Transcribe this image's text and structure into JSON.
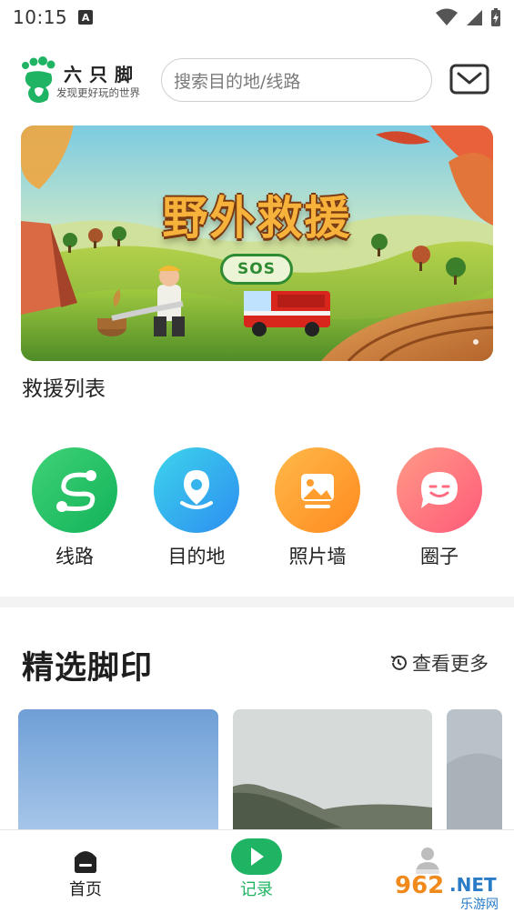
{
  "status_bar": {
    "time": "10:15",
    "notification_letter": "A"
  },
  "header": {
    "brand_name": "六只脚",
    "slogan": "发现更好玩的世界",
    "search_placeholder": "搜索目的地/线路"
  },
  "banner": {
    "title": "野外救援",
    "badge": "SOS"
  },
  "rescue_list_label": "救援列表",
  "quick_nav": [
    {
      "label": "线路",
      "icon": "route-icon",
      "color_from": "#3fd276",
      "color_to": "#13b25a"
    },
    {
      "label": "目的地",
      "icon": "location-pin-icon",
      "color_from": "#3dd4ec",
      "color_to": "#2d8ef0"
    },
    {
      "label": "照片墙",
      "icon": "photo-icon",
      "color_from": "#ffb94a",
      "color_to": "#ff8a1f"
    },
    {
      "label": "圈子",
      "icon": "chat-bubble-icon",
      "color_from": "#ff9a86",
      "color_to": "#ff5a7a"
    }
  ],
  "featured": {
    "title": "精选脚印",
    "view_more": "查看更多"
  },
  "bottom_nav": [
    {
      "label": "首页",
      "icon": "home-icon",
      "active": false
    },
    {
      "label": "记录",
      "icon": "record-icon",
      "active": true
    },
    {
      "label": "",
      "icon": "profile-icon",
      "active": false
    }
  ],
  "watermark": {
    "brand": "962.NET",
    "subtitle": "乐游网"
  },
  "colors": {
    "brand_green": "#1fb463",
    "accent_green": "#1fb463"
  }
}
